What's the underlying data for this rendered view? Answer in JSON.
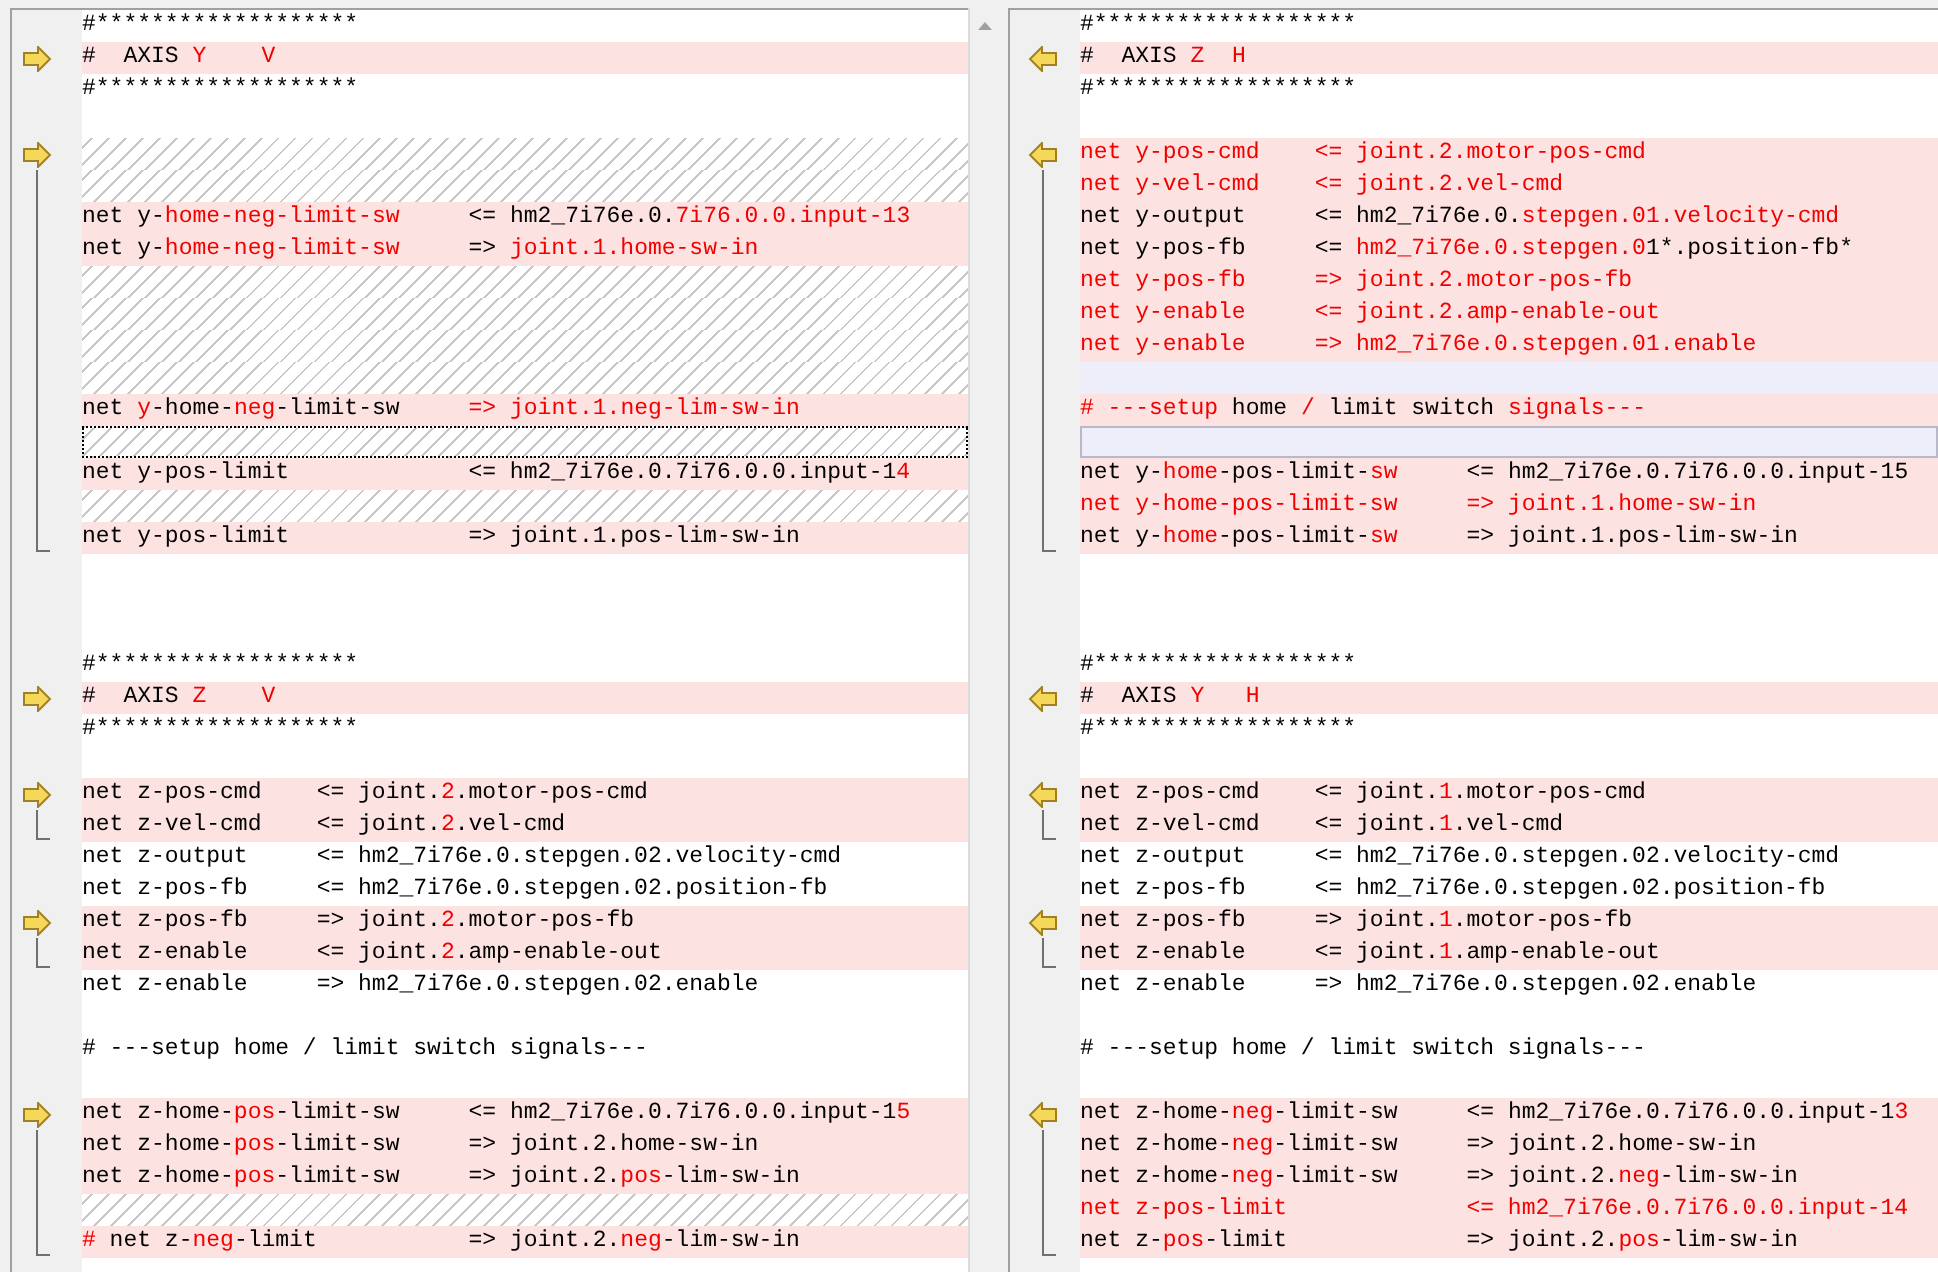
{
  "panes": [
    {
      "lines": [
        {
          "kind": "same",
          "text": "#*******************"
        },
        {
          "kind": "diff",
          "text": "#  AXIS *Y*    *V*"
        },
        {
          "kind": "same",
          "text": "#*******************"
        },
        {
          "kind": "blank"
        },
        {
          "kind": "hatch"
        },
        {
          "kind": "hatch"
        },
        {
          "kind": "diff",
          "text": "net y-*home-neg-limit-sw*     <= hm2_7i76e.0.*7i76.0.0.input-13*"
        },
        {
          "kind": "diff",
          "text": "net y-*home-neg-limit-sw*     => *joint.1.home-sw-in*"
        },
        {
          "kind": "hatch"
        },
        {
          "kind": "hatch"
        },
        {
          "kind": "hatch"
        },
        {
          "kind": "hatch"
        },
        {
          "kind": "diff",
          "text": "net *y*-home-*neg*-limit-sw     *=> joint.1.neg-lim-sw-in*"
        },
        {
          "kind": "focus-hatch"
        },
        {
          "kind": "diff",
          "text": "net y-pos-limit             <= hm2_7i76e.0.7i76.0.0.input-1**4**"
        },
        {
          "kind": "hatch"
        },
        {
          "kind": "diff",
          "text": "net y-pos-limit             => joint.1.pos-lim-sw-in"
        },
        {
          "kind": "blank"
        },
        {
          "kind": "blank"
        },
        {
          "kind": "blank"
        },
        {
          "kind": "same",
          "text": "#*******************"
        },
        {
          "kind": "diff",
          "text": "#  AXIS *Z*    *V*"
        },
        {
          "kind": "same",
          "text": "#*******************"
        },
        {
          "kind": "blank"
        },
        {
          "kind": "diff",
          "text": "net z-pos-cmd    <= joint.*2*.motor-pos-cmd"
        },
        {
          "kind": "diff",
          "text": "net z-vel-cmd    <= joint.*2*.vel-cmd"
        },
        {
          "kind": "same",
          "text": "net z-output     <= hm2_7i76e.0.stepgen.02.velocity-cmd"
        },
        {
          "kind": "same",
          "text": "net z-pos-fb     <= hm2_7i76e.0.stepgen.02.position-fb"
        },
        {
          "kind": "diff",
          "text": "net z-pos-fb     => joint.*2*.motor-pos-fb"
        },
        {
          "kind": "diff",
          "text": "net z-enable     <= joint.*2*.amp-enable-out"
        },
        {
          "kind": "same",
          "text": "net z-enable     => hm2_7i76e.0.stepgen.02.enable"
        },
        {
          "kind": "blank"
        },
        {
          "kind": "same",
          "text": "# ---setup home / limit switch signals---"
        },
        {
          "kind": "blank"
        },
        {
          "kind": "diff",
          "text": "net z-home-*pos*-limit-sw     <= hm2_7i76e.0.7i76.0.0.input-1**5**"
        },
        {
          "kind": "diff",
          "text": "net z-home-*pos*-limit-sw     => joint.2.home-sw-in"
        },
        {
          "kind": "diff",
          "text": "net z-home-*pos*-limit-sw     => joint.2.*pos*-lim-sw-in"
        },
        {
          "kind": "hatch"
        },
        {
          "kind": "diff",
          "text": "*#* net z-*neg*-limit           => joint.2.*neg*-lim-sw-in"
        }
      ]
    },
    {
      "lines": [
        {
          "kind": "same",
          "text": "#*******************"
        },
        {
          "kind": "diff",
          "text": "#  AXIS *Z*  *H*"
        },
        {
          "kind": "same",
          "text": "#*******************"
        },
        {
          "kind": "blank"
        },
        {
          "kind": "changed",
          "text": "net y-pos-cmd    <= joint.2.motor-pos-cmd"
        },
        {
          "kind": "changed",
          "text": "net y-vel-cmd    <= joint.2.vel-cmd"
        },
        {
          "kind": "diff",
          "text": "net y-output     <= hm2_7i76e.0.*stepgen.01.velocity-cmd*"
        },
        {
          "kind": "diff",
          "text": "net y-pos-fb     <= **hm2_7i76e.0.stepgen.0**1*.position-fb*"
        },
        {
          "kind": "changed",
          "text": "net y-pos-fb     => joint.2.motor-pos-fb"
        },
        {
          "kind": "changed",
          "text": "net y-enable     <= joint.2.amp-enable-out"
        },
        {
          "kind": "changed",
          "text": "net y-enable     => hm2_7i76e.0.stepgen.01.enable"
        },
        {
          "kind": "gap"
        },
        {
          "kind": "diff",
          "text": "*# ---setup* home */* limit switch *signals---*"
        },
        {
          "kind": "focus-gap"
        },
        {
          "kind": "diff",
          "text": "net y-*home*-pos-limit-*sw*     <= hm2_7i76e.0.7i76.0.0.input-15"
        },
        {
          "kind": "changed",
          "text": "net y-home-pos-limit-sw     => joint.1.home-sw-in"
        },
        {
          "kind": "diff",
          "text": "net y-*home*-pos-limit-*sw*     => joint.1.pos-lim-sw-in"
        },
        {
          "kind": "blank"
        },
        {
          "kind": "blank"
        },
        {
          "kind": "blank"
        },
        {
          "kind": "same",
          "text": "#*******************"
        },
        {
          "kind": "diff",
          "text": "#  AXIS *Y*   *H*"
        },
        {
          "kind": "same",
          "text": "#*******************"
        },
        {
          "kind": "blank"
        },
        {
          "kind": "diff",
          "text": "net z-pos-cmd    <= joint.*1*.motor-pos-cmd"
        },
        {
          "kind": "diff",
          "text": "net z-vel-cmd    <= joint.*1*.vel-cmd"
        },
        {
          "kind": "same",
          "text": "net z-output     <= hm2_7i76e.0.stepgen.02.velocity-cmd"
        },
        {
          "kind": "same",
          "text": "net z-pos-fb     <= hm2_7i76e.0.stepgen.02.position-fb"
        },
        {
          "kind": "diff",
          "text": "net z-pos-fb     => joint.*1*.motor-pos-fb"
        },
        {
          "kind": "diff",
          "text": "net z-enable     <= joint.*1*.amp-enable-out"
        },
        {
          "kind": "same",
          "text": "net z-enable     => hm2_7i76e.0.stepgen.02.enable"
        },
        {
          "kind": "blank"
        },
        {
          "kind": "same",
          "text": "# ---setup home / limit switch signals---"
        },
        {
          "kind": "blank"
        },
        {
          "kind": "diff",
          "text": "net z-home-*neg*-limit-sw     <= hm2_7i76e.0.7i76.0.0.input-1**3**"
        },
        {
          "kind": "diff",
          "text": "net z-home-*neg*-limit-sw     => joint.2.home-sw-in"
        },
        {
          "kind": "diff",
          "text": "net z-home-*neg*-limit-sw     => joint.2.*neg*-lim-sw-in"
        },
        {
          "kind": "changed",
          "text": "net z-pos-limit             <= hm2_7i76e.0.7i76.0.0.input-14"
        },
        {
          "kind": "diff",
          "text": "net z-*pos*-limit             => joint.2.*pos*-lim-sw-in"
        }
      ]
    }
  ]
}
